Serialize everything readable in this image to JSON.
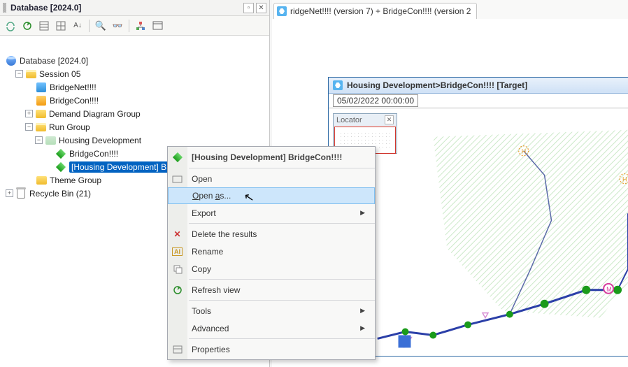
{
  "panel": {
    "title": "Database [2024.0]"
  },
  "tree": {
    "root": "Database [2024.0]",
    "session": "Session 05",
    "bridgenet": "BridgeNet!!!!",
    "bridgecon": "BridgeCon!!!!",
    "demand_group": "Demand Diagram Group",
    "run_group": "Run Group",
    "housing_dev": "Housing Development",
    "run_bridgecon": "BridgeCon!!!!",
    "run_selected": "[Housing Development] BridgeCon!!!!",
    "theme_group": "Theme Group",
    "recycle": "Recycle Bin (21)"
  },
  "doc_tab": "ridgeNet!!!! (version 7) + BridgeCon!!!! (version 2",
  "map_window": {
    "title": "Housing Development>BridgeCon!!!!  [Target]",
    "date": "05/02/2022 00:00:00",
    "locator_title": "Locator"
  },
  "context_menu": {
    "header": "[Housing Development] BridgeCon!!!!",
    "open": "Open",
    "open_as": "Open as...",
    "export": "Export",
    "delete": "Delete the results",
    "rename": "Rename",
    "copy": "Copy",
    "refresh": "Refresh view",
    "tools": "Tools",
    "advanced": "Advanced",
    "properties": "Properties"
  }
}
